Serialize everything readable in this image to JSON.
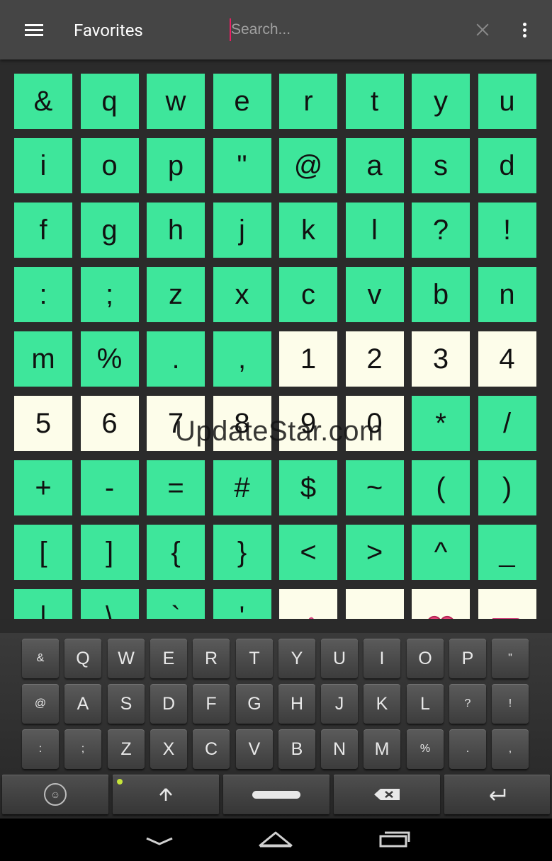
{
  "app": {
    "title": "Favorites"
  },
  "search": {
    "placeholder": "Search...",
    "value": ""
  },
  "icons": {
    "menu": "hamburger-menu-icon",
    "clear": "close-icon",
    "overflow": "more-vertical-icon"
  },
  "colors": {
    "actionbar": "#454545",
    "cell_green": "#3ee69b",
    "cell_cream": "#fdfdea",
    "cursor": "#e91e63"
  },
  "grid": {
    "cells": [
      {
        "t": "&",
        "c": "green"
      },
      {
        "t": "q",
        "c": "green"
      },
      {
        "t": "w",
        "c": "green"
      },
      {
        "t": "e",
        "c": "green"
      },
      {
        "t": "r",
        "c": "green"
      },
      {
        "t": "t",
        "c": "green"
      },
      {
        "t": "y",
        "c": "green"
      },
      {
        "t": "u",
        "c": "green"
      },
      {
        "t": "i",
        "c": "green"
      },
      {
        "t": "o",
        "c": "green"
      },
      {
        "t": "p",
        "c": "green"
      },
      {
        "t": "\"",
        "c": "green"
      },
      {
        "t": "@",
        "c": "green"
      },
      {
        "t": "a",
        "c": "green"
      },
      {
        "t": "s",
        "c": "green"
      },
      {
        "t": "d",
        "c": "green"
      },
      {
        "t": "f",
        "c": "green"
      },
      {
        "t": "g",
        "c": "green"
      },
      {
        "t": "h",
        "c": "green"
      },
      {
        "t": "j",
        "c": "green"
      },
      {
        "t": "k",
        "c": "green"
      },
      {
        "t": "l",
        "c": "green"
      },
      {
        "t": "?",
        "c": "green"
      },
      {
        "t": "!",
        "c": "green"
      },
      {
        "t": ":",
        "c": "green"
      },
      {
        "t": ";",
        "c": "green"
      },
      {
        "t": "z",
        "c": "green"
      },
      {
        "t": "x",
        "c": "green"
      },
      {
        "t": "c",
        "c": "green"
      },
      {
        "t": "v",
        "c": "green"
      },
      {
        "t": "b",
        "c": "green"
      },
      {
        "t": "n",
        "c": "green"
      },
      {
        "t": "m",
        "c": "green"
      },
      {
        "t": "%",
        "c": "green"
      },
      {
        "t": ".",
        "c": "green"
      },
      {
        "t": ",",
        "c": "green"
      },
      {
        "t": "1",
        "c": "cream"
      },
      {
        "t": "2",
        "c": "cream"
      },
      {
        "t": "3",
        "c": "cream"
      },
      {
        "t": "4",
        "c": "cream"
      },
      {
        "t": "5",
        "c": "cream"
      },
      {
        "t": "6",
        "c": "cream"
      },
      {
        "t": "7",
        "c": "cream"
      },
      {
        "t": "8",
        "c": "cream"
      },
      {
        "t": "9",
        "c": "cream"
      },
      {
        "t": "0",
        "c": "cream"
      },
      {
        "t": "*",
        "c": "green"
      },
      {
        "t": "/",
        "c": "green"
      },
      {
        "t": "+",
        "c": "green"
      },
      {
        "t": "-",
        "c": "green"
      },
      {
        "t": "=",
        "c": "green"
      },
      {
        "t": "#",
        "c": "green"
      },
      {
        "t": "$",
        "c": "green"
      },
      {
        "t": "~",
        "c": "green"
      },
      {
        "t": "(",
        "c": "green"
      },
      {
        "t": ")",
        "c": "green"
      },
      {
        "t": "[",
        "c": "green"
      },
      {
        "t": "]",
        "c": "green"
      },
      {
        "t": "{",
        "c": "green"
      },
      {
        "t": "}",
        "c": "green"
      },
      {
        "t": "<",
        "c": "green"
      },
      {
        "t": ">",
        "c": "green"
      },
      {
        "t": "^",
        "c": "green"
      },
      {
        "t": "_",
        "c": "green"
      },
      {
        "t": "|",
        "c": "green"
      },
      {
        "t": "\\",
        "c": "green"
      },
      {
        "t": "`",
        "c": "green"
      },
      {
        "t": "'",
        "c": "green"
      },
      {
        "t": "",
        "c": "emoji",
        "icon": "thumbs-up-emoji-icon"
      },
      {
        "t": "",
        "c": "emoji",
        "icon": "hundred-points-emoji-icon"
      },
      {
        "t": "",
        "c": "emoji",
        "icon": "heart-emoji-icon"
      },
      {
        "t": "",
        "c": "emoji",
        "icon": "thumbs-down-emoji-icon"
      }
    ]
  },
  "watermark": "UpdateStar.com",
  "keyboard": {
    "rows": [
      [
        {
          "k": "&",
          "s": 1
        },
        {
          "k": "Q"
        },
        {
          "k": "W"
        },
        {
          "k": "E"
        },
        {
          "k": "R"
        },
        {
          "k": "T"
        },
        {
          "k": "Y"
        },
        {
          "k": "U"
        },
        {
          "k": "I"
        },
        {
          "k": "O"
        },
        {
          "k": "P"
        },
        {
          "k": "\"",
          "s": 1
        }
      ],
      [
        {
          "k": "@",
          "s": 1
        },
        {
          "k": "A"
        },
        {
          "k": "S"
        },
        {
          "k": "D"
        },
        {
          "k": "F"
        },
        {
          "k": "G"
        },
        {
          "k": "H"
        },
        {
          "k": "J"
        },
        {
          "k": "K"
        },
        {
          "k": "L"
        },
        {
          "k": "?",
          "s": 1
        },
        {
          "k": "!",
          "s": 1
        }
      ],
      [
        {
          "k": ":",
          "s": 1
        },
        {
          "k": ";",
          "s": 1
        },
        {
          "k": "Z"
        },
        {
          "k": "X"
        },
        {
          "k": "C"
        },
        {
          "k": "V"
        },
        {
          "k": "B"
        },
        {
          "k": "N"
        },
        {
          "k": "M"
        },
        {
          "k": "%",
          "s": 1
        },
        {
          "k": ".",
          "s": 1
        },
        {
          "k": ",",
          "s": 1
        }
      ]
    ],
    "function_keys": [
      {
        "name": "emoji-keyboard-icon"
      },
      {
        "name": "shift-arrow-icon"
      },
      {
        "name": "space-bar"
      },
      {
        "name": "backspace-icon"
      },
      {
        "name": "enter-icon"
      }
    ]
  },
  "navigation": {
    "buttons": [
      "back-icon",
      "home-icon",
      "recent-apps-icon"
    ]
  }
}
